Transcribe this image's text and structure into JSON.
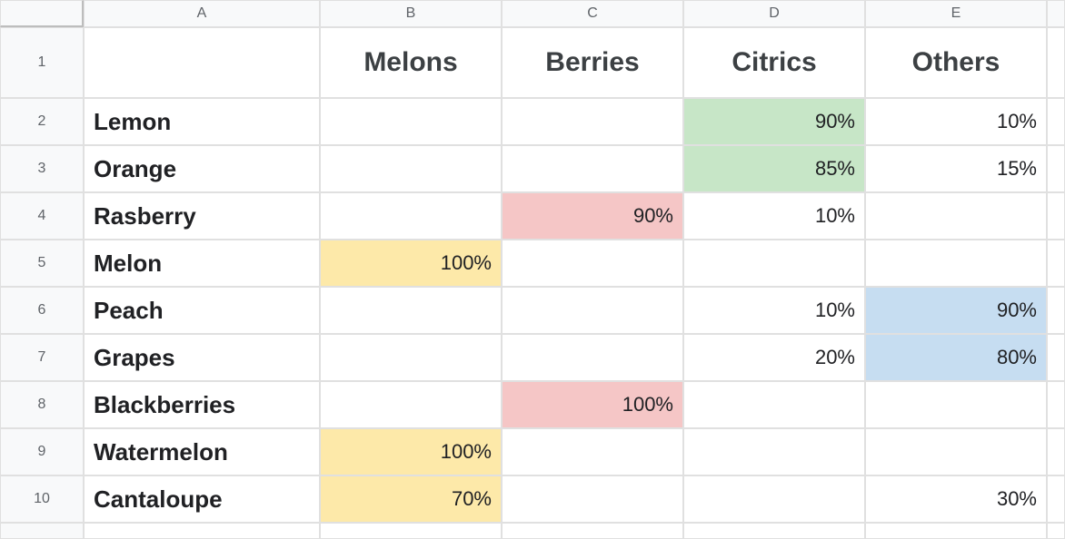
{
  "columns": [
    "A",
    "B",
    "C",
    "D",
    "E"
  ],
  "row_numbers": [
    "1",
    "2",
    "3",
    "4",
    "5",
    "6",
    "7",
    "8",
    "9",
    "10"
  ],
  "header_row": {
    "A": "",
    "B": "Melons",
    "C": "Berries",
    "D": "Citrics",
    "E": "Others"
  },
  "rows": [
    {
      "label": "Lemon",
      "B": "",
      "C": "",
      "D": "90%",
      "E": "10%"
    },
    {
      "label": "Orange",
      "B": "",
      "C": "",
      "D": "85%",
      "E": "15%"
    },
    {
      "label": "Rasberry",
      "B": "",
      "C": "90%",
      "D": "10%",
      "E": ""
    },
    {
      "label": "Melon",
      "B": "100%",
      "C": "",
      "D": "",
      "E": ""
    },
    {
      "label": "Peach",
      "B": "",
      "C": "",
      "D": "10%",
      "E": "90%"
    },
    {
      "label": "Grapes",
      "B": "",
      "C": "",
      "D": "20%",
      "E": "80%"
    },
    {
      "label": "Blackberries",
      "B": "",
      "C": "100%",
      "D": "",
      "E": ""
    },
    {
      "label": "Watermelon",
      "B": "100%",
      "C": "",
      "D": "",
      "E": ""
    },
    {
      "label": "Cantaloupe",
      "B": "70%",
      "C": "",
      "D": "",
      "E": "30%"
    }
  ],
  "highlights": {
    "yellow": "#fde9a9",
    "pink": "#f5c6c6",
    "green": "#c7e6c7",
    "blue": "#c6ddf1"
  },
  "chart_data": {
    "type": "table",
    "title": "",
    "columns": [
      "",
      "Melons",
      "Berries",
      "Citrics",
      "Others"
    ],
    "rows": [
      [
        "Lemon",
        null,
        null,
        90,
        10
      ],
      [
        "Orange",
        null,
        null,
        85,
        15
      ],
      [
        "Rasberry",
        null,
        90,
        10,
        null
      ],
      [
        "Melon",
        100,
        null,
        null,
        null
      ],
      [
        "Peach",
        null,
        null,
        10,
        90
      ],
      [
        "Grapes",
        null,
        null,
        20,
        80
      ],
      [
        "Blackberries",
        null,
        100,
        null,
        null
      ],
      [
        "Watermelon",
        100,
        null,
        null,
        null
      ],
      [
        "Cantaloupe",
        70,
        null,
        null,
        30
      ]
    ],
    "value_unit": "percent"
  }
}
